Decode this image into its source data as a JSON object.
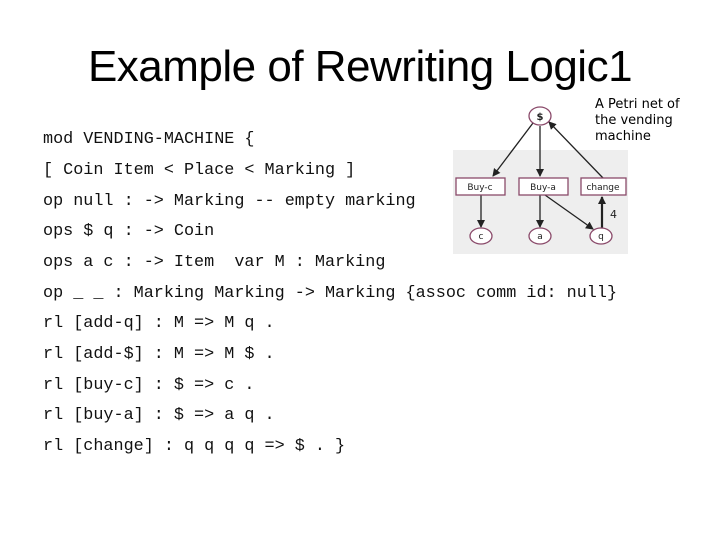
{
  "slide": {
    "title": "Example of Rewriting Logic1",
    "code_lines": [
      "mod VENDING-MACHINE {",
      "[ Coin Item < Place < Marking ]",
      "op null : -> Marking -- empty marking",
      "ops $ q : -> Coin",
      "ops a c : -> Item  var M : Marking",
      "op _ _ : Marking Marking -> Marking {assoc comm id: null}",
      "rl [add-q] : M => M q .",
      "rl [add-$] : M => M $ .",
      "rl [buy-c] : $ => c .",
      "rl [buy-a] : $ => a q .",
      "rl [change] : q q q q => $ . }"
    ]
  },
  "figure": {
    "caption_lines": [
      "A Petri net of",
      "the vending",
      "machine"
    ],
    "places": {
      "dollar": "$",
      "c": "c",
      "a": "a",
      "q": "q"
    },
    "transitions": {
      "buy_c": "Buy-c",
      "buy_a": "Buy-a",
      "change": "change"
    },
    "arc_weight_q_to_change": "4",
    "colors": {
      "node_border": "#8a4a6a",
      "background": "#eeeeee"
    }
  }
}
